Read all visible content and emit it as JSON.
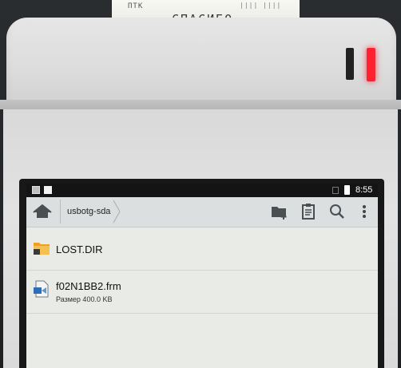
{
  "receipt": {
    "line1": "ПТК",
    "line2": "СПАСИБО",
    "line3": "|||| ||||"
  },
  "statusbar": {
    "time": "8:55"
  },
  "actionbar": {
    "breadcrumb": "usbotg-sda"
  },
  "files": [
    {
      "name": "LOST.DIR",
      "type": "folder"
    },
    {
      "name": "f02N1BB2.frm",
      "type": "file",
      "size": "Размер 400.0 KB"
    }
  ],
  "colors": {
    "indicator": "#ff2030",
    "folder": "#f0a020",
    "screen_bg": "#e9ebe7"
  }
}
